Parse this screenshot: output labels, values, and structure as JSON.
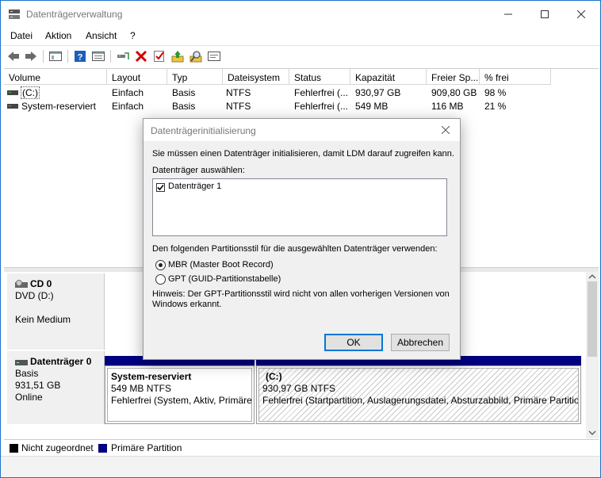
{
  "window": {
    "title": "Datenträgerverwaltung"
  },
  "menu": [
    "Datei",
    "Aktion",
    "Ansicht",
    "?"
  ],
  "toolbar": {
    "icons": [
      "back-icon",
      "forward-icon",
      "console-tree-icon",
      "help-icon",
      "properties-icon",
      "connect-icon",
      "delete-icon",
      "check-icon",
      "import-icon",
      "search-icon",
      "settings-icon"
    ],
    "colors": {
      "delete": "#d00000",
      "help": "#1c5fb8"
    }
  },
  "volume_list": {
    "columns": [
      "Volume",
      "Layout",
      "Typ",
      "Dateisystem",
      "Status",
      "Kapazität",
      "Freier Sp...",
      "% frei"
    ],
    "rows": [
      [
        "(C:)",
        "Einfach",
        "Basis",
        "NTFS",
        "Fehlerfrei (...",
        "930,97 GB",
        "909,80 GB",
        "98 %"
      ],
      [
        "System-reserviert",
        "Einfach",
        "Basis",
        "NTFS",
        "Fehlerfrei (...",
        "549 MB",
        "116 MB",
        "21 %"
      ]
    ]
  },
  "disks": [
    {
      "name": "CD 0",
      "line1": "DVD (D:)",
      "line2": "",
      "line3": "Kein Medium"
    },
    {
      "name": "Datenträger 0",
      "line1": "Basis",
      "line2": "931,51 GB",
      "line3": "Online",
      "partitions": [
        {
          "title": "System-reserviert",
          "size": "549 MB NTFS",
          "status": "Fehlerfrei (System, Aktiv, Primäre"
        },
        {
          "title": "(C:)",
          "size": "930,97 GB NTFS",
          "status": "Fehlerfrei (Startpartition, Auslagerungsdatei, Absturzabbild, Primäre Partitio"
        }
      ]
    }
  ],
  "legend": [
    {
      "label": "Nicht zugeordnet",
      "color": "#000000"
    },
    {
      "label": "Primäre Partition",
      "color": "#000080"
    }
  ],
  "dialog": {
    "title": "Datenträgerinitialisierung",
    "intro": "Sie müssen einen Datenträger initialisieren, damit LDM darauf zugreifen kann.",
    "select_label": "Datenträger auswählen:",
    "disk_item": "Datenträger 1",
    "disk_checked": true,
    "style_label": "Den folgenden Partitionsstil für die ausgewählten Datenträger verwenden:",
    "option_mbr": "MBR (Master Boot Record)",
    "option_gpt": "GPT (GUID-Partitionstabelle)",
    "selected_option": "MBR",
    "note_line1": "Hinweis: Der GPT-Partitionsstil wird nicht von allen vorherigen Versionen von",
    "note_line2": "Windows erkannt.",
    "ok": "OK",
    "cancel": "Abbrechen"
  }
}
